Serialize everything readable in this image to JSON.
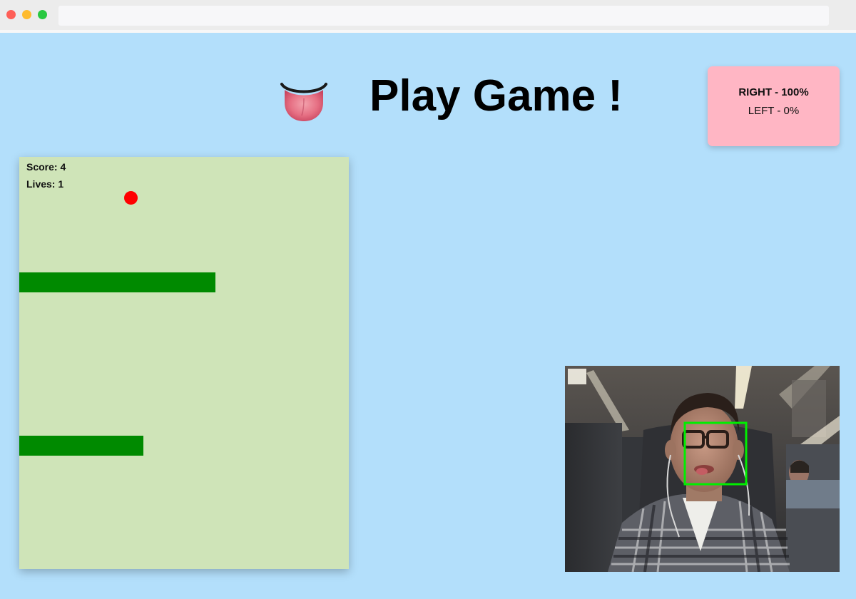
{
  "header": {
    "title": "Play Game !",
    "emoji_icon": "tongue-icon"
  },
  "direction": {
    "right_label": "RIGHT - 100%",
    "left_label": "LEFT - 0%"
  },
  "game": {
    "score_label": "Score: 4",
    "lives_label": "Lives: 1",
    "colors": {
      "board": "#cfe4b8",
      "paddle": "#008a00",
      "ball": "#ff0000"
    }
  },
  "webcam": {
    "face_box_color": "#00ee00"
  },
  "colors": {
    "background": "#b3dffb",
    "card": "#ffb6c4"
  }
}
